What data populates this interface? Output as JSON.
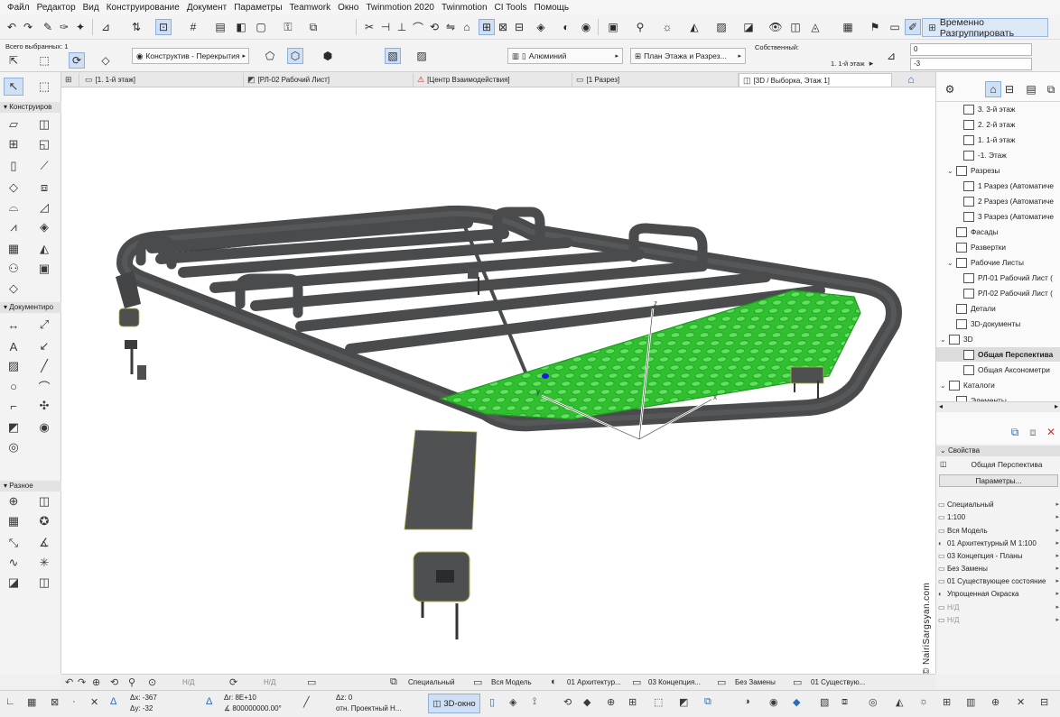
{
  "menu": [
    "Файл",
    "Редактор",
    "Вид",
    "Конструирование",
    "Документ",
    "Параметры",
    "Teamwork",
    "Окно",
    "Twinmotion 2020",
    "Twinmotion",
    "CI Tools",
    "Помощь"
  ],
  "toolbar": {
    "regroup_label": "Временно Разгруппировать",
    "selected_label": "Всего выбранных: 1",
    "structure_dropdown": "Конструктив - Перекрытия",
    "material_dropdown": "Алюминий",
    "floorplan_dropdown": "План Этажа и Разрез...",
    "own_label": "Собственный:",
    "floor_value": "1. 1-й этаж",
    "field_top": "0",
    "field_bottom": "-3"
  },
  "tabs": [
    {
      "label": "[1. 1-й этаж]",
      "icon": "floorplan-icon"
    },
    {
      "label": "[РЛ-02 Рабочий Лист]",
      "icon": "worksheet-icon"
    },
    {
      "label": "[Центр Взаимодействия]",
      "icon": "interaction-icon"
    },
    {
      "label": "[1 Разрез]",
      "icon": "section-icon"
    },
    {
      "label": "[3D / Выборка, Этаж 1]",
      "icon": "3d-icon"
    }
  ],
  "toolbox": {
    "sections": [
      "Конструиров",
      "Документиро",
      "Разное"
    ]
  },
  "navigator": {
    "items": [
      {
        "label": "3. 3-й этаж",
        "indent": 2
      },
      {
        "label": "2. 2-й этаж",
        "indent": 2
      },
      {
        "label": "1. 1-й этаж",
        "indent": 2
      },
      {
        "label": "-1. Этаж",
        "indent": 2
      },
      {
        "label": "Разрезы",
        "indent": 1,
        "caret": "v"
      },
      {
        "label": "1 Разрез (Автоматиче",
        "indent": 2
      },
      {
        "label": "2 Разрез (Автоматиче",
        "indent": 2
      },
      {
        "label": "3 Разрез (Автоматиче",
        "indent": 2
      },
      {
        "label": "Фасады",
        "indent": 1
      },
      {
        "label": "Развертки",
        "indent": 1
      },
      {
        "label": "Рабочие Листы",
        "indent": 1,
        "caret": "v"
      },
      {
        "label": "РЛ-01 Рабочий Лист (",
        "indent": 2
      },
      {
        "label": "РЛ-02 Рабочий Лист (",
        "indent": 2
      },
      {
        "label": "Детали",
        "indent": 1
      },
      {
        "label": "3D-документы",
        "indent": 1
      },
      {
        "label": "3D",
        "indent": 0,
        "caret": "v"
      },
      {
        "label": "Общая Перспектива",
        "indent": 1,
        "selected": true
      },
      {
        "label": "Общая Аксонометри",
        "indent": 1
      },
      {
        "label": "Каталоги",
        "indent": 0,
        "caret": "v"
      },
      {
        "label": "Элементы",
        "indent": 1,
        "caret": "v"
      }
    ]
  },
  "properties": {
    "header": "Свойства",
    "view_name": "Общая Перспектива",
    "params_button": "Параметры...",
    "rows": [
      "Специальный",
      "1:100",
      "Вся Модель",
      "01 Архитектурный М 1:100",
      "03 Концепция - Планы",
      "Без Замены",
      "01 Существующее состояние",
      "Упрощенная Окраска",
      "Н/Д",
      "Н/Д"
    ]
  },
  "status_bar": {
    "nd1": "Н/Д",
    "nd2": "Н/Д",
    "items": [
      "Специальный",
      "Вся Модель",
      "01 Архитектур...",
      "03 Концепция...",
      "Без Замены",
      "01 Существую..."
    ]
  },
  "coords": {
    "dx": "Δx: -367",
    "dy": "Δy: -32",
    "dr": "Δr: 8E+10",
    "angle": "∡ 800000000.00°",
    "dz": "Δz: 0",
    "ref": "отн. Проектный Н...",
    "mode_button": "3D-окно"
  },
  "viewport": {
    "axis_x": "x",
    "axis_y": "y",
    "axis_z": "z"
  },
  "watermark": "© NairiSargsyan.com",
  "colors": {
    "accent": "#4a90d9",
    "mesh_green": "#3bd13b",
    "rack_gray": "#4a4b4c"
  }
}
